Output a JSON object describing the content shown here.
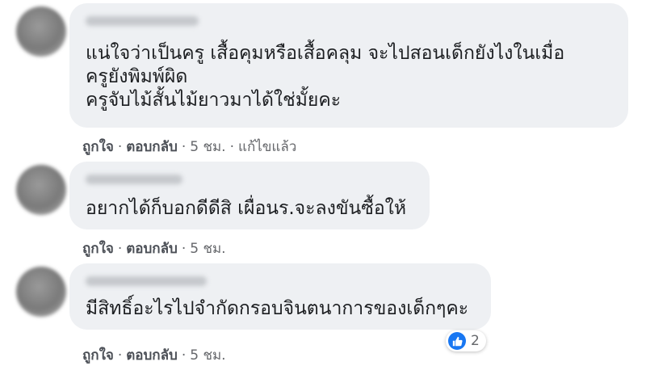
{
  "comments": [
    {
      "lines": [
        "แน่ใจว่าเป็นครู เสื้อคุมหรือเสื้อคลุม จะไปสอนเด็กยังไงในเมื่อ",
        "ครูยังพิมพ์ผิด",
        "ครูจับไม้สั้นไม้ยาวมาได้ใช่มั้ยคะ"
      ],
      "like": "ถูกใจ",
      "reply": "ตอบกลับ",
      "time": "5 ชม.",
      "edited": "แก้ไขแล้ว"
    },
    {
      "lines": [
        "อยากได้ก็บอกดีดีสิ เผื่อนร.จะลงขันซื้อให้"
      ],
      "like": "ถูกใจ",
      "reply": "ตอบกลับ",
      "time": "5 ชม."
    },
    {
      "lines": [
        "มีสิทธิ์อะไรไปจำกัดกรอบจินตนาการของเด็กๆคะ"
      ],
      "like": "ถูกใจ",
      "reply": "ตอบกลับ",
      "time": "5 ชม.",
      "reaction": {
        "icon": "like-icon",
        "count": "2"
      }
    }
  ],
  "colors": {
    "bubble": "#eef0f3",
    "like_blue": "#1877f2",
    "meta": "#65676b"
  }
}
